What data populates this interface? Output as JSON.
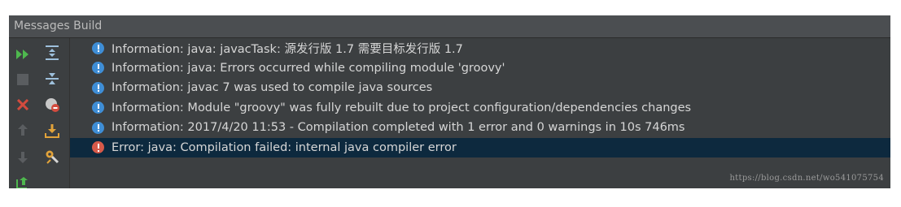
{
  "window": {
    "title": "Messages Build"
  },
  "toolbar": {
    "buttons": [
      {
        "icon": "rerun-icon",
        "color": "#4eb84e"
      },
      {
        "icon": "stop-icon",
        "color": "#5a5d60"
      },
      {
        "icon": "close-icon",
        "color": "#d24b3e"
      },
      {
        "icon": "up-arrow-icon",
        "color": "#5a5d60"
      },
      {
        "icon": "down-arrow-icon",
        "color": "#5a5d60"
      },
      {
        "icon": "export-icon",
        "color": "#4eb84e"
      },
      {
        "icon": "expand-all-icon",
        "color": "#9ec0dc"
      },
      {
        "icon": "collapse-all-icon",
        "color": "#9ec0dc"
      },
      {
        "icon": "filter-icon",
        "color": "#d24b3e"
      },
      {
        "icon": "download-icon",
        "color": "#e2a33a"
      },
      {
        "icon": "settings-icon",
        "color": "#e2a33a"
      }
    ]
  },
  "messages": [
    {
      "type": "info",
      "text": "Information: java: javacTask: 源发行版 1.7 需要目标发行版 1.7"
    },
    {
      "type": "info",
      "text": "Information: java: Errors occurred while compiling module 'groovy'"
    },
    {
      "type": "info",
      "text": "Information: javac 7 was used to compile java sources"
    },
    {
      "type": "info",
      "text": "Information: Module \"groovy\" was fully rebuilt due to project configuration/dependencies changes"
    },
    {
      "type": "info",
      "text": "Information: 2017/4/20 11:53 - Compilation completed with 1 error and 0 warnings in 10s 746ms"
    },
    {
      "type": "error",
      "text": "Error: java: Compilation failed: internal java compiler error",
      "selected": true
    }
  ],
  "watermark": "https://blog.csdn.net/wo541075754",
  "colors": {
    "panel_bg": "#3c3f41",
    "title_bg": "#4b4e51",
    "selected_bg": "#0d293e",
    "text": "#d6d6d6",
    "info_icon": "#3f8ed6",
    "error_icon": "#d75a4a"
  }
}
